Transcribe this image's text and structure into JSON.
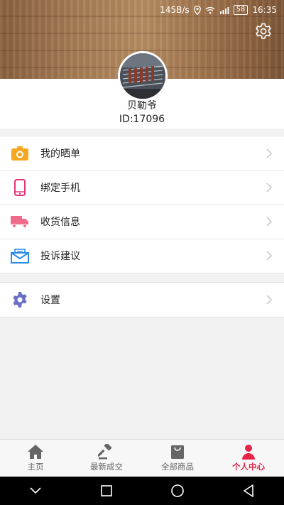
{
  "status_bar": {
    "speed": "145B/s",
    "battery": "58",
    "time": "16:35"
  },
  "profile": {
    "username": "贝勒爷",
    "user_id": "ID:17096"
  },
  "menu": {
    "items": [
      {
        "label": "我的晒单",
        "icon": "camera-icon"
      },
      {
        "label": "绑定手机",
        "icon": "phone-icon"
      },
      {
        "label": "收货信息",
        "icon": "truck-icon"
      },
      {
        "label": "投诉建议",
        "icon": "mail-icon"
      }
    ],
    "settings": {
      "label": "设置",
      "icon": "gear-icon"
    }
  },
  "tabs": [
    {
      "label": "主页",
      "icon": "home-icon",
      "active": false
    },
    {
      "label": "最新成交",
      "icon": "gavel-icon",
      "active": false
    },
    {
      "label": "全部商品",
      "icon": "bag-icon",
      "active": false
    },
    {
      "label": "个人中心",
      "icon": "person-icon",
      "active": true
    }
  ],
  "colors": {
    "accent": "#e8234a",
    "camera": "#f5a623",
    "phone": "#e4347c",
    "truck": "#f06a8c",
    "mail": "#2b8be6",
    "gear": "#6a6fc6"
  }
}
